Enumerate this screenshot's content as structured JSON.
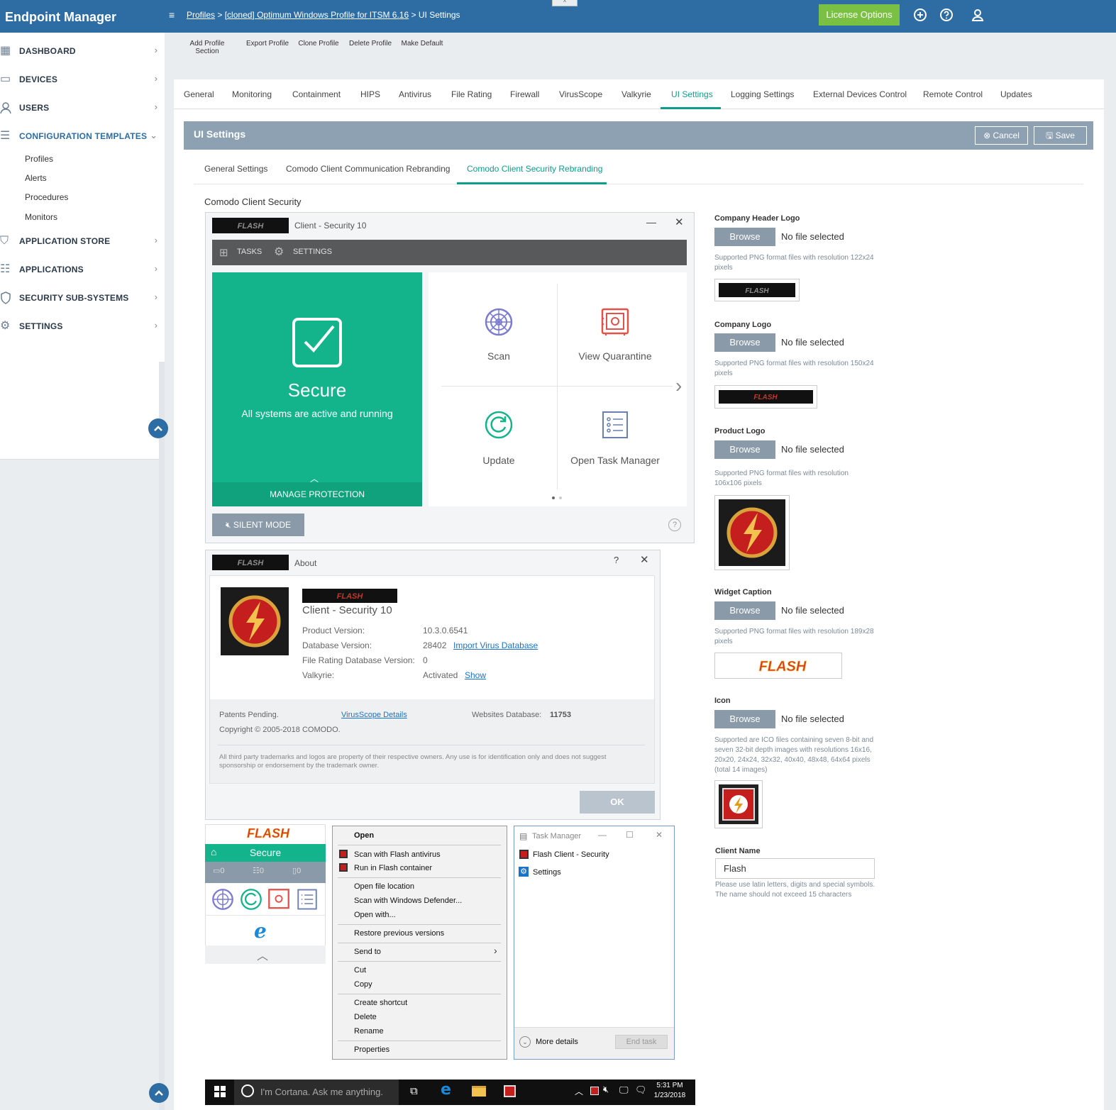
{
  "app": {
    "title": "Endpoint Manager",
    "collapse_glyph": "^"
  },
  "breadcrumb": {
    "profiles": "Profiles",
    "profile_name": "[cloned] Optimum Windows Profile for ITSM 6.16",
    "current": "UI Settings",
    "sep": ">"
  },
  "header": {
    "license_label": "License Options"
  },
  "sidebar": {
    "items": [
      {
        "label": "DASHBOARD",
        "icon": "grid-icon"
      },
      {
        "label": "DEVICES",
        "icon": "devices-icon"
      },
      {
        "label": "USERS",
        "icon": "user-icon"
      },
      {
        "label": "CONFIGURATION TEMPLATES",
        "icon": "templates-icon"
      },
      {
        "label": "APPLICATION STORE",
        "icon": "store-icon"
      },
      {
        "label": "APPLICATIONS",
        "icon": "applications-icon"
      },
      {
        "label": "SECURITY SUB-SYSTEMS",
        "icon": "shield-icon"
      },
      {
        "label": "SETTINGS",
        "icon": "gear-icon"
      }
    ],
    "subitems": [
      "Profiles",
      "Alerts",
      "Procedures",
      "Monitors"
    ]
  },
  "toolbar": {
    "add_profile_section_1": "Add Profile",
    "add_profile_section_2": "Section",
    "export_profile": "Export Profile",
    "clone_profile": "Clone Profile",
    "delete_profile": "Delete Profile",
    "make_default": "Make Default"
  },
  "tabs": [
    "General",
    "Monitoring",
    "Containment",
    "HIPS",
    "Antivirus",
    "File Rating",
    "Firewall",
    "VirusScope",
    "Valkyrie",
    "UI Settings",
    "Logging Settings",
    "External Devices Control",
    "Remote Control",
    "Updates"
  ],
  "section": {
    "title": "UI Settings",
    "cancel": "Cancel",
    "save": "Save"
  },
  "subtabs": [
    "General Settings",
    "Comodo Client Communication Rebranding",
    "Comodo Client Security Rebranding"
  ],
  "preview": {
    "label": "Comodo Client Security",
    "client_window": {
      "title": "Client - Security  10",
      "tasks": "TASKS",
      "settings": "SETTINGS",
      "status": "Secure",
      "status_sub": "All systems are active and running",
      "manage": "MANAGE PROTECTION",
      "tiles": [
        "Scan",
        "View Quarantine",
        "Update",
        "Open Task Manager"
      ],
      "silent_mode": "SILENT MODE"
    },
    "about": {
      "title": "About",
      "product": "Client - Security 10",
      "rows": [
        {
          "key": "Product Version:",
          "value": "10.3.0.6541",
          "link": ""
        },
        {
          "key": "Database Version:",
          "value": "28402",
          "link": "Import Virus Database"
        },
        {
          "key": "File Rating Database Version:",
          "value": "0",
          "link": ""
        },
        {
          "key": "Valkyrie:",
          "value": "Activated",
          "link": "Show"
        }
      ],
      "patents": "Patents Pending.",
      "virusscope_link": "VirusScope Details",
      "websites_label": "Websites Database:",
      "websites_value": "11753",
      "copyright": "Copyright © 2005-2018 COMODO.",
      "disclaimer": "All third party trademarks and logos are property of their respective owners. Any use is for identification only and does not suggest sponsorship or endorsement by the trademark owner.",
      "ok": "OK"
    },
    "widget": {
      "status": "Secure",
      "counts": [
        "0",
        "0",
        "0"
      ]
    },
    "context_menu": {
      "open": "Open",
      "items": [
        "Scan with Flash antivirus",
        "Run in Flash container",
        "Open file location",
        "Scan with Windows Defender...",
        "Open with...",
        "Restore previous versions",
        "Send to",
        "Cut",
        "Copy",
        "Create shortcut",
        "Delete",
        "Rename",
        "Properties"
      ]
    },
    "task_manager": {
      "title": "Task Manager",
      "rows": [
        "Flash Client - Security",
        "Settings"
      ],
      "more_details": "More details",
      "end_task": "End task"
    },
    "taskbar": {
      "cortana": "I'm Cortana. Ask me anything.",
      "time": "5:31 PM",
      "date": "1/23/2018"
    },
    "logo_text": "FLASH"
  },
  "right": {
    "browse": "Browse",
    "no_file": "No file selected",
    "fields": [
      {
        "label": "Company Header Logo",
        "hint": "Supported PNG format files with resolution 122x24 pixels"
      },
      {
        "label": "Company Logo",
        "hint": "Supported PNG format files with resolution 150x24 pixels"
      },
      {
        "label": "Product Logo",
        "hint": "Supported PNG format files with resolution 106x106 pixels"
      },
      {
        "label": "Widget Caption",
        "hint": "Supported PNG format files with resolution 189x28 pixels"
      },
      {
        "label": "Icon",
        "hint": "Supported are ICO files containing seven 8-bit and seven 32-bit depth images with resolutions 16x16, 20x20, 24x24, 32x32, 40x40, 48x48, 64x64 pixels (total 14 images)"
      }
    ],
    "client_name_label": "Client Name",
    "client_name_value": "Flash",
    "client_name_hint": "Please use latin letters, digits and special symbols. The name should not exceed 15 characters"
  },
  "colors": {
    "brand": "#2e6da4",
    "accent": "#0f9b8e",
    "green": "#13b48c",
    "license": "#7ac143"
  }
}
